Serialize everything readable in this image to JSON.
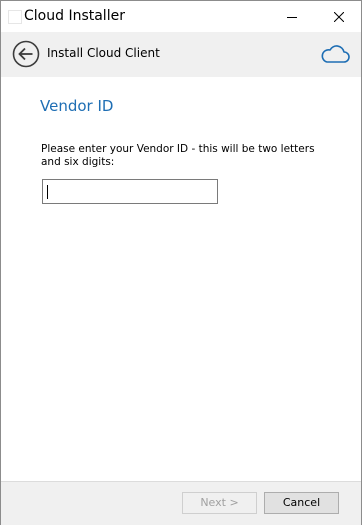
{
  "window": {
    "title": "Cloud Installer"
  },
  "header": {
    "title": "Install Cloud Client"
  },
  "main": {
    "page_title": "Vendor ID",
    "prompt": "Please enter your Vendor ID - this will be two letters and six digits:",
    "vendor_id_value": ""
  },
  "footer": {
    "next_label": "Next >",
    "cancel_label": "Cancel"
  },
  "colors": {
    "accent": "#1e6eb4",
    "header_bg": "#f0f0f0",
    "footer_bg": "#f0f0f0"
  },
  "icons": {
    "back": "back-arrow-circle-icon",
    "cloud": "cloud-icon",
    "minimize": "minimize-icon",
    "close": "close-icon"
  }
}
